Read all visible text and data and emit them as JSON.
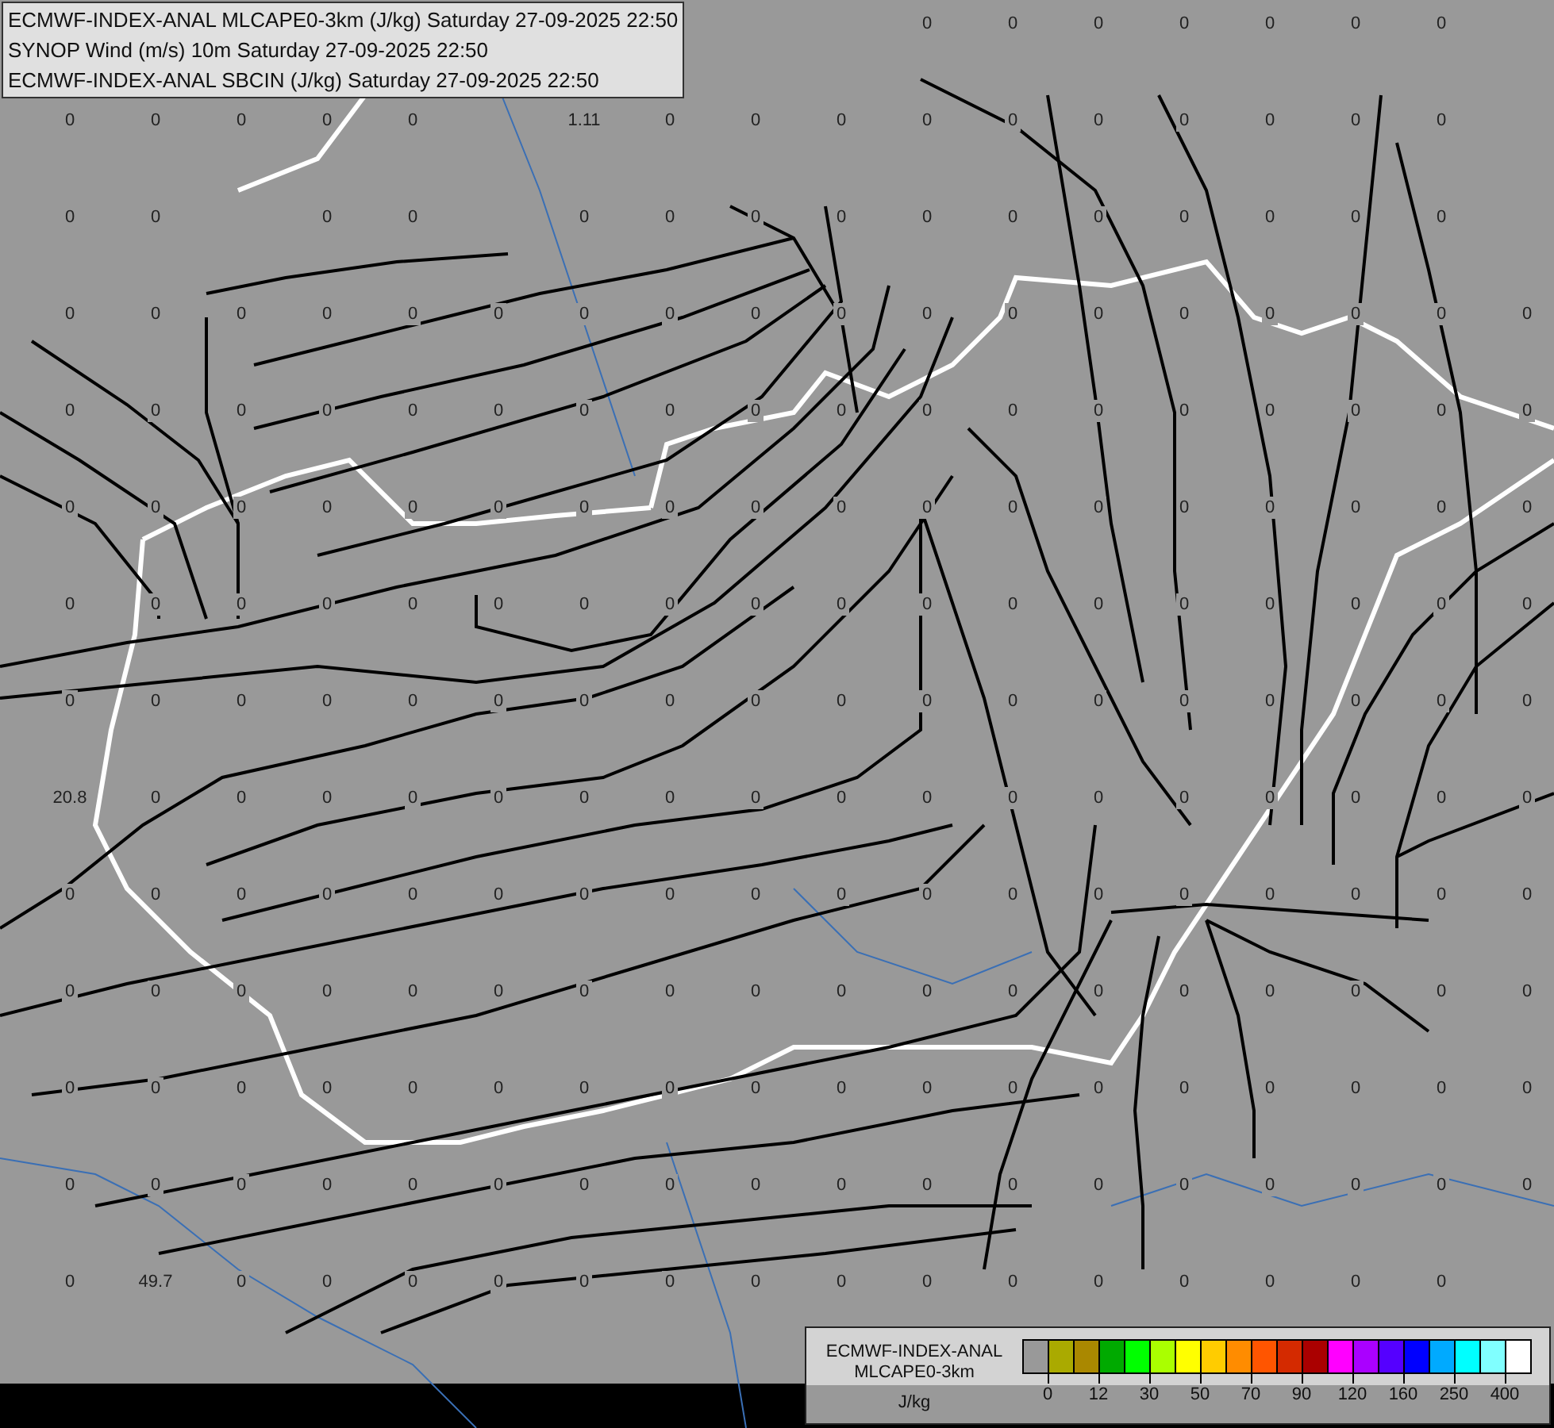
{
  "header": {
    "lines": [
      "ECMWF-INDEX-ANAL MLCAPE0-3km (J/kg) Saturday 27-09-2025 22:50",
      "SYNOP Wind (m/s) 10m Saturday 27-09-2025 22:50",
      "ECMWF-INDEX-ANAL SBCIN (J/kg) Saturday 27-09-2025 22:50"
    ]
  },
  "map": {
    "value_rows": [
      [
        null,
        null,
        null,
        null,
        null,
        null,
        null,
        null,
        null,
        null,
        "0",
        "0",
        "0",
        "0",
        "0",
        "0",
        "0",
        null
      ],
      [
        "0",
        "0",
        "0",
        "0",
        "0",
        null,
        "1.11",
        "0",
        "0",
        "0",
        "0",
        "0",
        "0",
        "0",
        "0",
        "0",
        "0",
        null
      ],
      [
        "0",
        "0",
        null,
        "0",
        "0",
        null,
        "0",
        "0",
        "0",
        "0",
        "0",
        "0",
        "0",
        "0",
        "0",
        "0",
        "0",
        null
      ],
      [
        "0",
        "0",
        "0",
        "0",
        "0",
        "0",
        "0",
        "0",
        "0",
        "0",
        "0",
        "0",
        "0",
        "0",
        "0",
        "0",
        "0",
        "0"
      ],
      [
        "0",
        "0",
        "0",
        "0",
        "0",
        "0",
        "0",
        "0",
        "0",
        "0",
        "0",
        "0",
        "0",
        "0",
        "0",
        "0",
        "0",
        "0"
      ],
      [
        "0",
        "0",
        "0",
        "0",
        "0",
        "0",
        "0",
        "0",
        "0",
        "0",
        "0",
        "0",
        "0",
        "0",
        "0",
        "0",
        "0",
        "0"
      ],
      [
        "0",
        "0",
        "0",
        "0",
        "0",
        "0",
        "0",
        "0",
        "0",
        "0",
        "0",
        "0",
        "0",
        "0",
        "0",
        "0",
        "0",
        "0"
      ],
      [
        "0",
        "0",
        "0",
        "0",
        "0",
        "0",
        "0",
        "0",
        "0",
        "0",
        "0",
        "0",
        "0",
        "0",
        "0",
        "0",
        "0",
        "0"
      ],
      [
        "20.8",
        "0",
        "0",
        "0",
        "0",
        "0",
        "0",
        "0",
        "0",
        "0",
        "0",
        "0",
        "0",
        "0",
        "0",
        "0",
        "0",
        "0"
      ],
      [
        "0",
        "0",
        "0",
        "0",
        "0",
        "0",
        "0",
        "0",
        "0",
        "0",
        "0",
        "0",
        "0",
        "0",
        "0",
        "0",
        "0",
        "0"
      ],
      [
        "0",
        "0",
        "0",
        "0",
        "0",
        "0",
        "0",
        "0",
        "0",
        "0",
        "0",
        "0",
        "0",
        "0",
        "0",
        "0",
        "0",
        "0"
      ],
      [
        "0",
        "0",
        "0",
        "0",
        "0",
        "0",
        "0",
        "0",
        "0",
        "0",
        "0",
        "0",
        "0",
        "0",
        "0",
        "0",
        "0",
        "0"
      ],
      [
        "0",
        "0",
        "0",
        "0",
        "0",
        "0",
        "0",
        "0",
        "0",
        "0",
        "0",
        "0",
        "0",
        "0",
        "0",
        "0",
        "0",
        "0"
      ],
      [
        "0",
        "49.7",
        "0",
        "0",
        "0",
        "0",
        "0",
        "0",
        "0",
        "0",
        "0",
        "0",
        "0",
        "0",
        "0",
        "0",
        "0",
        null
      ]
    ]
  },
  "legend": {
    "title_lines": [
      "ECMWF-INDEX-ANAL",
      "MLCAPE0-3km"
    ],
    "unit": "J/kg",
    "swatches": [
      {
        "color": "#999999"
      },
      {
        "color": "#aaaa00"
      },
      {
        "color": "#aa8800"
      },
      {
        "color": "#00aa00"
      },
      {
        "color": "#00ff00"
      },
      {
        "color": "#aaff00"
      },
      {
        "color": "#ffff00"
      },
      {
        "color": "#ffcc00"
      },
      {
        "color": "#ff8c00"
      },
      {
        "color": "#ff5500"
      },
      {
        "color": "#d42a00"
      },
      {
        "color": "#aa0000"
      },
      {
        "color": "#ff00ff"
      },
      {
        "color": "#aa00ff"
      },
      {
        "color": "#5500ff"
      },
      {
        "color": "#0000ff"
      },
      {
        "color": "#00aaff"
      },
      {
        "color": "#00ffff"
      },
      {
        "color": "#80ffff"
      },
      {
        "color": "#ffffff"
      }
    ],
    "ticks": [
      "0",
      "12",
      "30",
      "50",
      "70",
      "90",
      "120",
      "160",
      "250",
      "400"
    ]
  }
}
